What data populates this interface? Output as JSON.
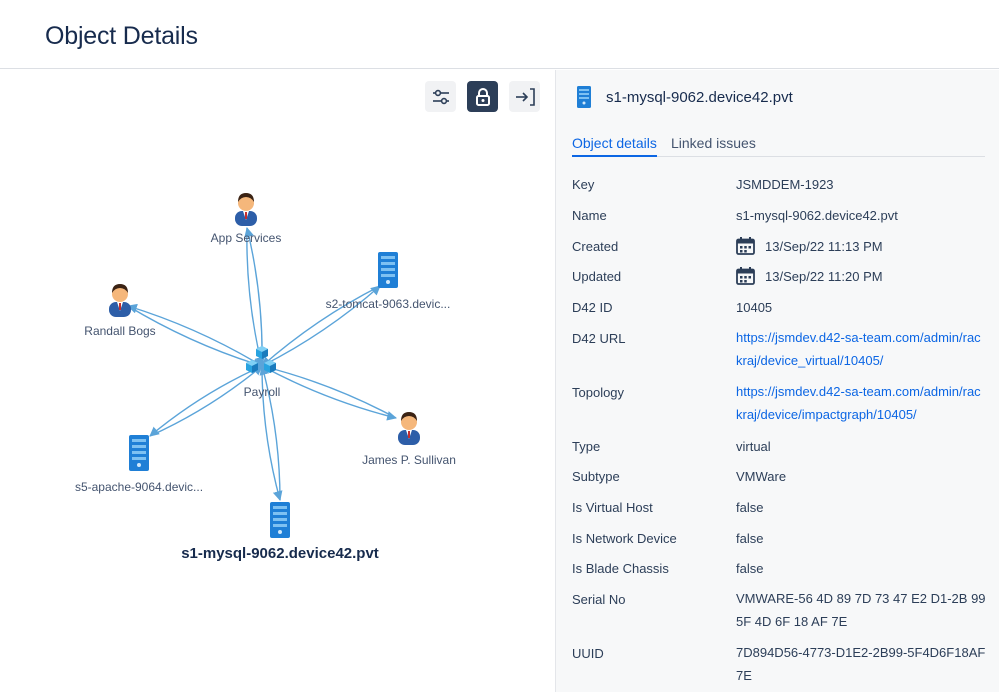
{
  "header": {
    "title": "Object Details"
  },
  "toolbar": {
    "filter_icon": "sliders-icon",
    "lock_icon": "lock-icon",
    "collapse_icon": "panel-collapse-icon"
  },
  "graph": {
    "center": {
      "label": "Payroll",
      "icon": "cluster-icon"
    },
    "nodes": [
      {
        "id": "app",
        "label": "App Services",
        "icon": "person-icon"
      },
      {
        "id": "randall",
        "label": "Randall Bogs",
        "icon": "person-icon"
      },
      {
        "id": "tomcat",
        "label": "s2-tomcat-9063.devic...",
        "icon": "server-icon"
      },
      {
        "id": "james",
        "label": "James P. Sullivan",
        "icon": "person-icon"
      },
      {
        "id": "apache",
        "label": "s5-apache-9064.devic...",
        "icon": "server-icon"
      },
      {
        "id": "mysql",
        "label": "s1-mysql-9062.device42.pvt",
        "icon": "server-icon"
      }
    ]
  },
  "details": {
    "title": "s1-mysql-9062.device42.pvt",
    "icon": "server-icon",
    "tabs": [
      {
        "label": "Object details",
        "active": true
      },
      {
        "label": "Linked issues",
        "active": false
      }
    ],
    "fields": {
      "key": {
        "label": "Key",
        "value": "JSMDDEM-1923"
      },
      "name": {
        "label": "Name",
        "value": "s1-mysql-9062.device42.pvt"
      },
      "created": {
        "label": "Created",
        "value": "13/Sep/22 11:13 PM"
      },
      "updated": {
        "label": "Updated",
        "value": "13/Sep/22 11:20 PM"
      },
      "d42id": {
        "label": "D42 ID",
        "value": "10405"
      },
      "d42url": {
        "label": "D42 URL",
        "value": "https://jsmdev.d42-sa-team.com/admin/rackraj/device_virtual/10405/"
      },
      "topology": {
        "label": "Topology",
        "value": "https://jsmdev.d42-sa-team.com/admin/rackraj/device/impactgraph/10405/"
      },
      "type": {
        "label": "Type",
        "value": "virtual"
      },
      "subtype": {
        "label": "Subtype",
        "value": "VMWare"
      },
      "is_virtual_host": {
        "label": "Is Virtual Host",
        "value": "false"
      },
      "is_network_device": {
        "label": "Is Network Device",
        "value": "false"
      },
      "is_blade_chassis": {
        "label": "Is Blade Chassis",
        "value": "false"
      },
      "serial_no": {
        "label": "Serial No",
        "value": "VMWARE-56 4D 89 7D 73 47 E2 D1-2B 99 5F 4D 6F 18 AF 7E"
      },
      "uuid": {
        "label": "UUID",
        "value": "7D894D56-4773-D1E2-2B99-5F4D6F18AF7E"
      }
    }
  },
  "colors": {
    "accent": "#0c66e4",
    "edge": "#5ba4d9",
    "server": "#1f7fd6",
    "person_shirt": "#2d5ea8",
    "person_skin": "#f5b77b",
    "person_hair": "#3b2314"
  }
}
